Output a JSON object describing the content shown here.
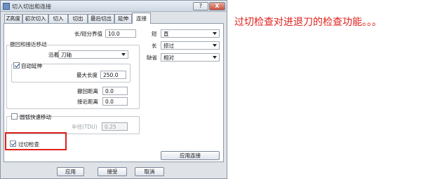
{
  "window": {
    "title": "切入切出和连接",
    "help_label": "?",
    "close_label": "X"
  },
  "tabs": [
    {
      "label": "Z高度"
    },
    {
      "label": "初次切入"
    },
    {
      "label": "切入"
    },
    {
      "label": "切出"
    },
    {
      "label": "最后切出"
    },
    {
      "label": "延伸"
    },
    {
      "label": "连接",
      "active": true
    }
  ],
  "panel": {
    "long_short_threshold": {
      "label": "长/短分界值",
      "value": "10.0"
    },
    "short": {
      "label": "短",
      "value": "直"
    },
    "long": {
      "label": "长",
      "value": "掠过"
    },
    "default": {
      "label": "缺省",
      "value": "相对"
    },
    "retract_approach": {
      "title": "撤回和接近移动",
      "along": {
        "label": "沿着",
        "value": "刀轴"
      },
      "auto_extend": {
        "label": "自动延伸",
        "checked": true,
        "max_length": {
          "label": "最大长度",
          "value": "250.0"
        }
      },
      "retract_distance": {
        "label": "撤回距离",
        "value": "0.0"
      },
      "approach_distance": {
        "label": "接近距离",
        "value": "0.0"
      }
    },
    "arc_rapid": {
      "label": "圆弧快速移动",
      "checked": false,
      "radius": {
        "label": "半径(TDU)",
        "value": "0.25"
      }
    },
    "gouge_check": {
      "label": "过切检查",
      "checked": true
    },
    "apply_links_label": "应用连接"
  },
  "footer": {
    "apply_label": "应用",
    "accept_label": "接受",
    "cancel_label": "取消"
  },
  "annotation": {
    "text": "过切检查对进退刀的检查功能。。。",
    "color": "#e0201c"
  }
}
